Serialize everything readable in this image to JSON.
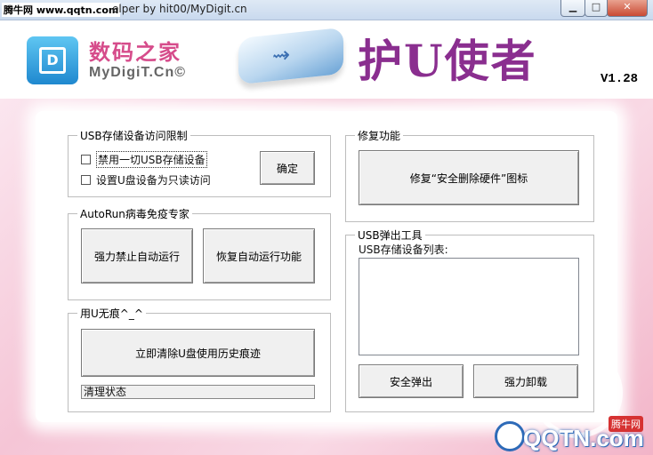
{
  "window": {
    "watermark": "腾牛网 www.qqtn.com",
    "title": "elper by hit00/MyDigit.cn",
    "min_glyph": "▁",
    "max_glyph": "□",
    "close_glyph": "✕"
  },
  "header": {
    "brand_cn": "数码之家",
    "brand_en": "MyDigiT.Cn©",
    "logo_letter": "D",
    "usb_mark": "⇝",
    "app_title": "护U使者",
    "version": "V1.28"
  },
  "usb_limit": {
    "legend": "USB存储设备访问限制",
    "disable_all_label": "禁用一切USB存储设备",
    "readonly_label": "设置U盘设备为只读访问",
    "ok_label": "确定"
  },
  "autorun": {
    "legend": "AutoRun病毒免疫专家",
    "block_label": "强力禁止自动运行",
    "restore_label": "恢复自动运行功能"
  },
  "clean": {
    "legend": "用U无痕^_^",
    "clear_label": "立即清除U盘使用历史痕迹",
    "status": "清理状态"
  },
  "repair": {
    "legend": "修复功能",
    "repair_label": "修复“安全删除硬件”图标"
  },
  "eject": {
    "legend": "USB弹出工具",
    "list_label": "USB存储设备列表:",
    "safe_eject_label": "安全弹出",
    "force_unmount_label": "强力卸载"
  },
  "watermark_corner": {
    "badge": "腾牛网",
    "text": "QQTN.com"
  }
}
